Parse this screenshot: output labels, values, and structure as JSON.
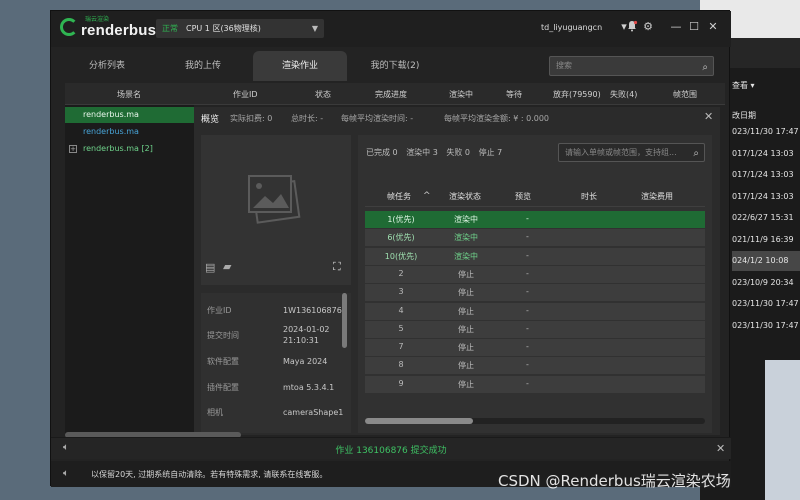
{
  "background_window": {
    "view_label": "查看 ▾",
    "col_label": "改日期",
    "rows": [
      "023/11/30 17:47",
      "017/1/24 13:03",
      "017/1/24 13:03",
      "017/1/24 13:03",
      "022/6/27 15:31",
      "021/11/9 16:39",
      "024/1/2 10:08",
      "023/10/9 20:34",
      "023/11/30 17:47",
      "023/11/30 17:47"
    ],
    "selected_row_index": 6
  },
  "titlebar": {
    "logo_sub": "瑞云渲染",
    "logo": "renderbus",
    "zone_status": "正常",
    "zone_name": "CPU 1 区(36物理核)",
    "username": "td_liyuguangcn"
  },
  "tabs": [
    {
      "label": "分析列表",
      "active": false
    },
    {
      "label": "我的上传",
      "active": false
    },
    {
      "label": "渲染作业",
      "active": true
    },
    {
      "label": "我的下载(2)",
      "active": false
    }
  ],
  "search_top_placeholder": "搜索",
  "scene_header": [
    "场景名",
    "作业ID",
    "状态",
    "完成进度",
    "渲染中",
    "等待",
    "放弃(79590)",
    "失败(4)",
    "帧范围"
  ],
  "files": [
    {
      "name": "renderbus.ma",
      "style": "sel"
    },
    {
      "name": "renderbus.ma",
      "style": "blue"
    },
    {
      "name": "renderbus.ma [2]",
      "style": "green"
    }
  ],
  "overview": {
    "title": "概览",
    "stats": [
      "实际扣费: 0",
      "总时长: -",
      "每帧平均渲染时间: -",
      "每帧平均渲染金额: ¥ : 0.000"
    ]
  },
  "details": [
    {
      "label": "作业ID",
      "value": "1W136106876"
    },
    {
      "label": "提交时间",
      "value": "2024-01-02\n21:10:31"
    },
    {
      "label": "软件配置",
      "value": "Maya 2024"
    },
    {
      "label": "插件配置",
      "value": "mtoa 5.3.4.1"
    },
    {
      "label": "相机",
      "value": "cameraShape1"
    }
  ],
  "frame_counts": [
    "已完成 0",
    "渲染中 3",
    "失败 0",
    "停止 7"
  ],
  "frame_search_placeholder": "请输入单帧或帧范围，支持组...",
  "frame_header": [
    "帧任务",
    "渲染状态",
    "预览",
    "时长",
    "渲染费用"
  ],
  "frame_rows": [
    {
      "task": "1(优先)",
      "status": "渲染中",
      "preview": "-",
      "running": true
    },
    {
      "task": "6(优先)",
      "status": "渲染中",
      "preview": "-",
      "running": true
    },
    {
      "task": "10(优先)",
      "status": "渲染中",
      "preview": "-",
      "running": true
    },
    {
      "task": "2",
      "status": "停止",
      "preview": "-",
      "running": false
    },
    {
      "task": "3",
      "status": "停止",
      "preview": "-",
      "running": false
    },
    {
      "task": "4",
      "status": "停止",
      "preview": "-",
      "running": false
    },
    {
      "task": "5",
      "status": "停止",
      "preview": "-",
      "running": false
    },
    {
      "task": "7",
      "status": "停止",
      "preview": "-",
      "running": false
    },
    {
      "task": "8",
      "status": "停止",
      "preview": "-",
      "running": false
    },
    {
      "task": "9",
      "status": "停止",
      "preview": "-",
      "running": false
    }
  ],
  "selected_frame_index": 0,
  "notification": "作业 136106876 提交成功",
  "notice": "以保留20天, 过期系统自动清除。若有特殊需求, 请联系在线客服。",
  "watermark": "CSDN @Renderbus瑞云渲染农场",
  "colors": {
    "accent": "#2fb552",
    "selected_row": "#1f6b34"
  }
}
